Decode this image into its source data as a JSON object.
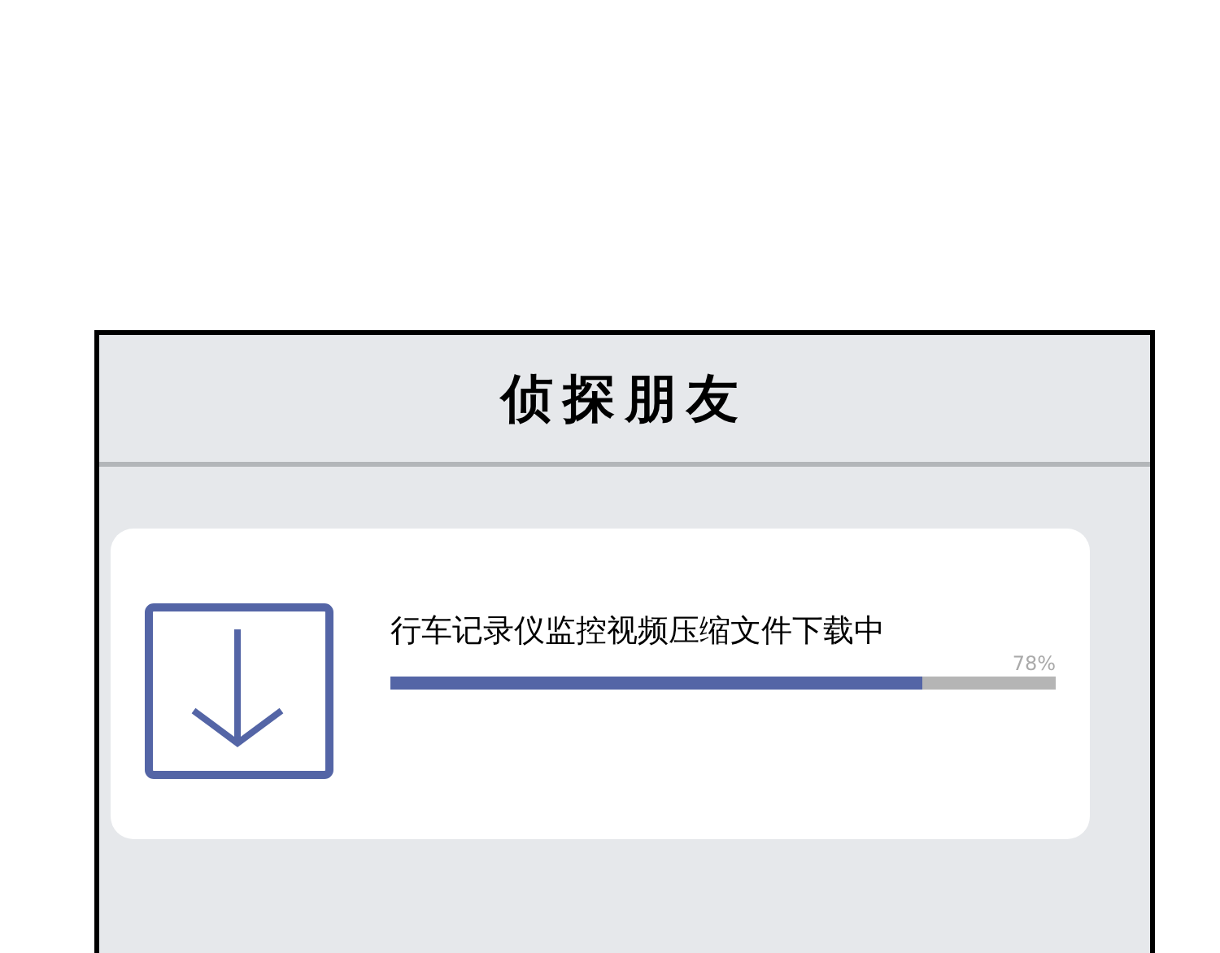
{
  "app": {
    "title": "侦探朋友"
  },
  "download": {
    "name": "行车记录仪监控视频压缩文件下载中",
    "percent": "78%",
    "level": 0.8
  }
}
